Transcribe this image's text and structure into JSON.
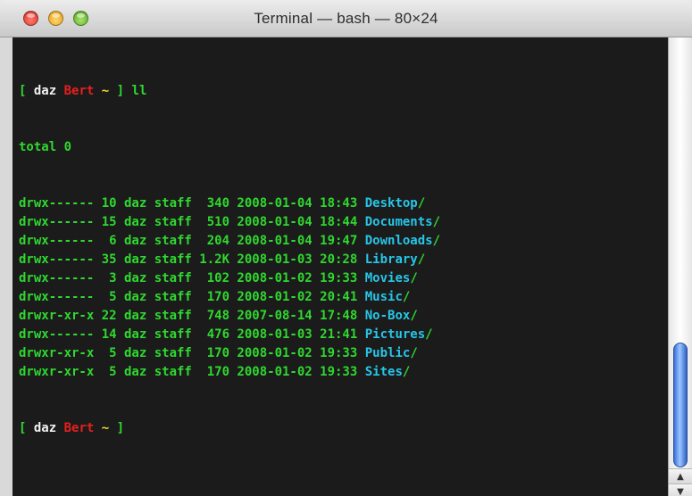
{
  "window": {
    "title": "Terminal — bash — 80×24"
  },
  "icons": {
    "close": "close-button-red-circle",
    "minimize": "minimize-button-yellow-circle",
    "zoom": "zoom-button-green-circle",
    "scroll_up": "arrow-up-icon",
    "scroll_down": "arrow-down-icon"
  },
  "colors": {
    "terminal_bg": "#1b1b1b",
    "text_green": "#2fd82f",
    "dir_cyan": "#27c6e8",
    "host_red": "#e81f1f",
    "tilde_yellow": "#f0dc28",
    "user_white": "#f2f2f2"
  },
  "terminal": {
    "prompt": {
      "open": "[",
      "user": "daz",
      "host": "Bert",
      "path": "~",
      "close": "]"
    },
    "command": "ll",
    "total": "total 0",
    "entries": [
      {
        "meta": "drwx------ 10 daz staff  340 2008-01-04 18:43 ",
        "name": "Desktop",
        "slash": "/"
      },
      {
        "meta": "drwx------ 15 daz staff  510 2008-01-04 18:44 ",
        "name": "Documents",
        "slash": "/"
      },
      {
        "meta": "drwx------  6 daz staff  204 2008-01-04 19:47 ",
        "name": "Downloads",
        "slash": "/"
      },
      {
        "meta": "drwx------ 35 daz staff 1.2K 2008-01-03 20:28 ",
        "name": "Library",
        "slash": "/"
      },
      {
        "meta": "drwx------  3 daz staff  102 2008-01-02 19:33 ",
        "name": "Movies",
        "slash": "/"
      },
      {
        "meta": "drwx------  5 daz staff  170 2008-01-02 20:41 ",
        "name": "Music",
        "slash": "/"
      },
      {
        "meta": "drwxr-xr-x 22 daz staff  748 2007-08-14 17:48 ",
        "name": "No-Box",
        "slash": "/"
      },
      {
        "meta": "drwx------ 14 daz staff  476 2008-01-03 21:41 ",
        "name": "Pictures",
        "slash": "/"
      },
      {
        "meta": "drwxr-xr-x  5 daz staff  170 2008-01-02 19:33 ",
        "name": "Public",
        "slash": "/"
      },
      {
        "meta": "drwxr-xr-x  5 daz staff  170 2008-01-02 19:33 ",
        "name": "Sites",
        "slash": "/"
      }
    ]
  }
}
